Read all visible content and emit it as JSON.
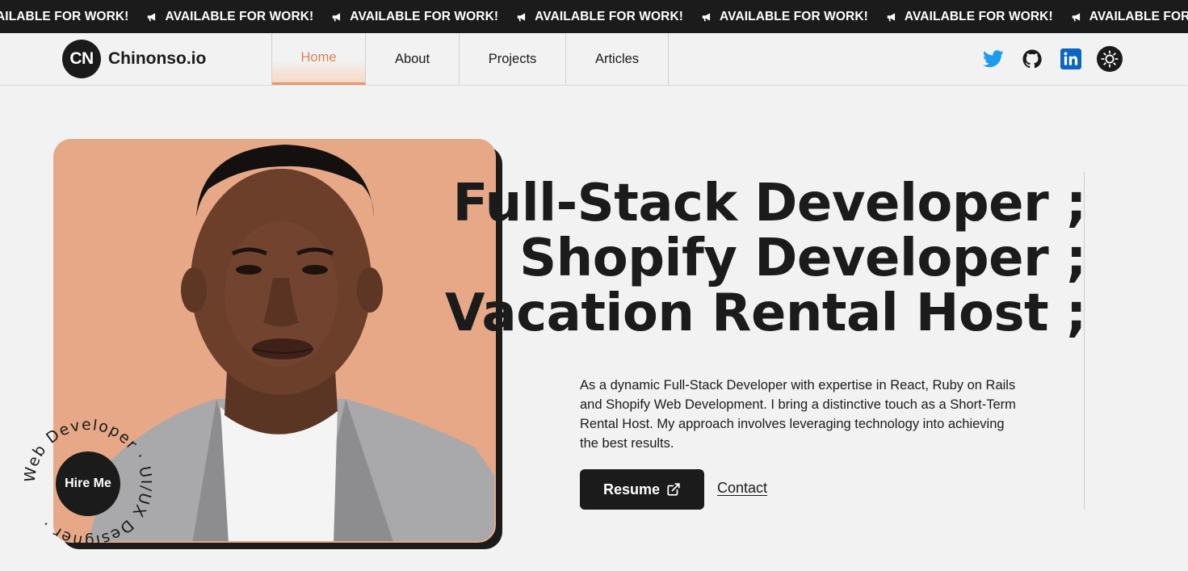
{
  "marquee": {
    "items": [
      "AILABLE FOR WORK!",
      "AVAILABLE FOR WORK!",
      "AVAILABLE FOR WORK!",
      "AVAILABLE FOR WORK!",
      "AVAILABLE FOR WORK!",
      "AVAILABLE FOR WORK!",
      "AVAILABLE FOR WORK!"
    ],
    "icon": "megaphone-icon"
  },
  "header": {
    "logo_badge": "CN",
    "logo_text": "Chinonso.io",
    "nav": [
      {
        "label": "Home",
        "active": true
      },
      {
        "label": "About",
        "active": false
      },
      {
        "label": "Projects",
        "active": false
      },
      {
        "label": "Articles",
        "active": false
      }
    ],
    "socials": [
      "twitter-icon",
      "github-icon",
      "linkedin-icon"
    ],
    "theme_toggle_icon": "sun-icon"
  },
  "hero": {
    "headline": [
      "Full-Stack Developer ;",
      "Shopify Developer ;",
      "Vacation Rental Host ;"
    ],
    "intro": "As a dynamic Full-Stack Developer with expertise in React, Ruby on Rails and Shopify Web Development. I bring a distinctive touch as a Short-Term Rental Host. My approach involves leveraging technology into achieving the best results.",
    "resume_label": "Resume",
    "contact_label": "Contact",
    "hire_label": "Hire Me",
    "ring_text": "Web Developer · UI/UX Designer ·"
  },
  "colors": {
    "accent": "#e39a6c",
    "photo_bg": "#e6a886",
    "dark": "#1b1b1b",
    "page_bg": "#f2f2f2"
  }
}
